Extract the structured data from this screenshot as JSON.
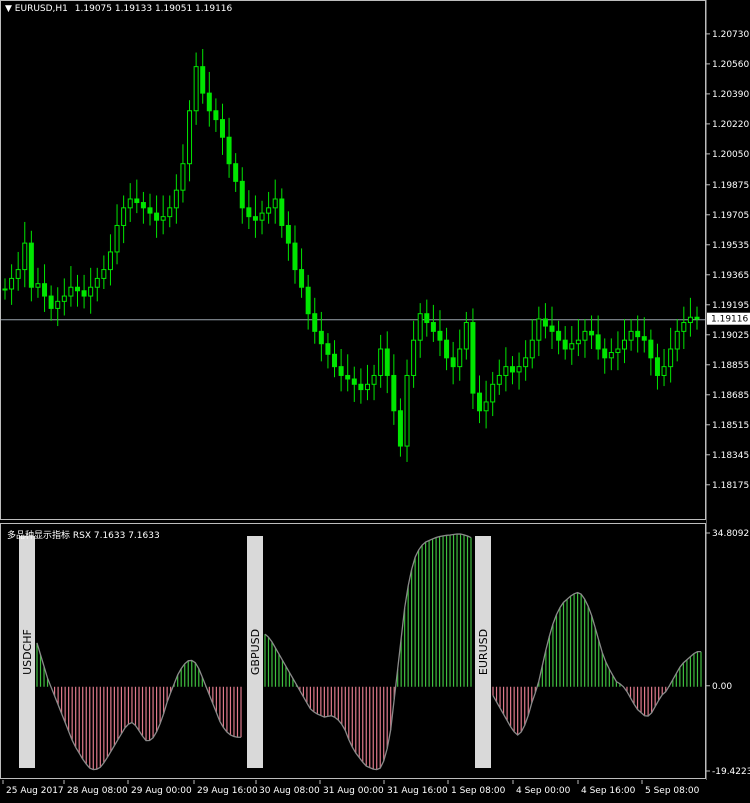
{
  "main": {
    "symbol": "EURUSD,H1",
    "ohlc": "1.19075 1.19133 1.19051 1.19116",
    "current_price": 1.19116,
    "current_price_label": "1.19116",
    "ymin": 1.181,
    "ymax": 1.2082,
    "price_labels": [
      "1.20730",
      "1.20560",
      "1.20390",
      "1.20220",
      "1.20050",
      "1.19875",
      "1.19705",
      "1.19535",
      "1.19365",
      "1.19195",
      "1.19025",
      "1.18855",
      "1.18685",
      "1.18515",
      "1.18345",
      "1.18175"
    ]
  },
  "indicator": {
    "title": "多品种显示指标 RSX 7.1633 7.1633",
    "top_label": "34.8092",
    "zero_label": "0.00",
    "bottom_label": "-19.4223",
    "max": 34.8092,
    "min": -19.4223,
    "positive_color": "#3fbf3f",
    "negative_color": "#e07a8c",
    "symbols": [
      "USDCHF",
      "GBPUSD",
      "EURUSD"
    ]
  },
  "time_labels": [
    "25 Aug 2017",
    "28 Aug 08:00",
    "29 Aug 00:00",
    "29 Aug 16:00",
    "30 Aug 08:00",
    "31 Aug 00:00",
    "31 Aug 16:00",
    "1 Sep 08:00",
    "4 Sep 00:00",
    "4 Sep 16:00",
    "5 Sep 08:00"
  ],
  "chart_data": [
    {
      "type": "candlestick",
      "title": "EURUSD,H1",
      "ylim": [
        1.181,
        1.2082
      ],
      "series": [
        {
          "name": "EURUSD,H1",
          "close": [
            1.1929,
            1.1935,
            1.194,
            1.1955,
            1.193,
            1.1932,
            1.1925,
            1.1918,
            1.1922,
            1.1925,
            1.193,
            1.1928,
            1.1925,
            1.193,
            1.1935,
            1.194,
            1.195,
            1.1965,
            1.1975,
            1.198,
            1.1978,
            1.1975,
            1.1972,
            1.1968,
            1.197,
            1.1975,
            1.1985,
            1.2,
            1.203,
            1.2055,
            1.204,
            1.203,
            1.2025,
            1.2015,
            1.2,
            1.199,
            1.1975,
            1.197,
            1.1968,
            1.1972,
            1.1975,
            1.198,
            1.1965,
            1.1955,
            1.194,
            1.193,
            1.1915,
            1.1905,
            1.1898,
            1.1892,
            1.1885,
            1.188,
            1.1878,
            1.1875,
            1.1872,
            1.1875,
            1.188,
            1.1895,
            1.188,
            1.186,
            1.184,
            1.188,
            1.19,
            1.1915,
            1.191,
            1.1905,
            1.19,
            1.189,
            1.1885,
            1.1895,
            1.191,
            1.187,
            1.186,
            1.1865,
            1.1875,
            1.188,
            1.1885,
            1.1882,
            1.1885,
            1.189,
            1.19,
            1.1912,
            1.1908,
            1.1905,
            1.19,
            1.1895,
            1.1898,
            1.19,
            1.1905,
            1.1903,
            1.1895,
            1.189,
            1.1893,
            1.1895,
            1.19,
            1.1905,
            1.1902,
            1.19,
            1.189,
            1.188,
            1.1885,
            1.1895,
            1.1905,
            1.191,
            1.1913,
            1.1912
          ]
        }
      ]
    },
    {
      "type": "bar",
      "title": "多品种显示指标 RSX 7.1633 7.1633",
      "ylim": [
        -19.4223,
        34.8092
      ],
      "series": [
        {
          "name": "USDCHF",
          "values": [
            10,
            6,
            2,
            -1,
            -4,
            -7,
            -10,
            -13,
            -15,
            -17,
            -18.5,
            -19,
            -18.5,
            -17,
            -15,
            -13,
            -11,
            -9,
            -8,
            -9,
            -11,
            -12.5,
            -12,
            -10,
            -7,
            -3,
            0,
            3,
            5,
            6,
            6,
            4,
            1,
            -2,
            -5,
            -8,
            -10,
            -11,
            -11.5,
            -11.5
          ]
        },
        {
          "name": "GBPUSD",
          "values": [
            12,
            11,
            9,
            7,
            5,
            3,
            1,
            -1,
            -3,
            -5,
            -6,
            -6.5,
            -7,
            -6.5,
            -7,
            -8,
            -10,
            -13,
            -15,
            -16.5,
            -18,
            -18.5,
            -19,
            -18.5,
            -16,
            -10,
            0,
            10,
            20,
            26,
            30,
            32,
            33,
            33.5,
            34,
            34.3,
            34.5,
            34.6,
            34.8,
            34.8,
            34.5,
            34
          ]
        },
        {
          "name": "EURUSD",
          "values": [
            -2,
            -4,
            -6,
            -8,
            -10,
            -11,
            -10,
            -7,
            -3,
            0,
            5,
            10,
            14,
            17,
            19,
            20,
            21,
            21.5,
            21,
            19,
            16,
            12,
            8,
            5,
            3,
            1,
            0.5,
            -1,
            -3,
            -5,
            -6,
            -7,
            -6,
            -4,
            -2,
            -1,
            1,
            3,
            5,
            6,
            7,
            8,
            8
          ]
        }
      ]
    }
  ]
}
